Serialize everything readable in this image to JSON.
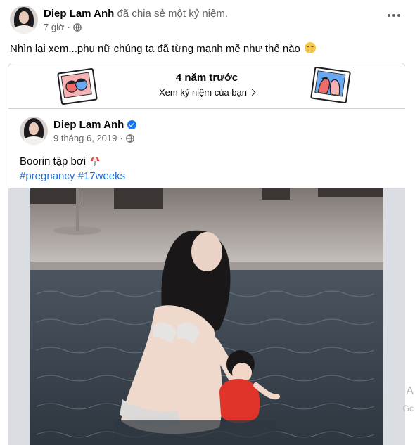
{
  "post": {
    "author": "Diep Lam Anh",
    "action": "đã chia sẻ một kỷ niệm.",
    "time": "7 giờ",
    "audience_icon": "globe-icon",
    "more_icon": "more-options-icon",
    "text": "Nhìn lại xem...phụ nữ chúng ta đã từng mạnh mẽ như thế nào",
    "text_emoji": "smiling-face-icon"
  },
  "memory": {
    "title": "4 năm trước",
    "link_label": "Xem kỷ niệm của bạn",
    "link_icon": "chevron-right-icon",
    "left_illustration": "friends-polaroid-icon",
    "right_illustration": "couple-polaroid-icon"
  },
  "shared_post": {
    "author": "Diep Lam Anh",
    "verified_icon": "verified-badge-icon",
    "date": "9 tháng 6, 2019",
    "audience_icon": "globe-icon",
    "caption": "Boorin tập bơi",
    "caption_emoji": "beach-umbrella-icon",
    "hashtags": [
      "#pregnancy",
      "#17weeks"
    ]
  },
  "colors": {
    "link_blue": "#216fdb",
    "verified_blue": "#1877f2",
    "secondary_text": "#65676b",
    "border": "#ced0d4"
  },
  "side_fragment": {
    "letter_top": "A",
    "letter_bottom": "Gc"
  }
}
